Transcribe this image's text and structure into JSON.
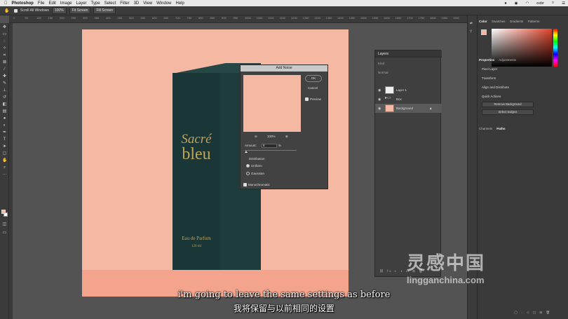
{
  "menubar": {
    "app": "Photoshop",
    "items": [
      "File",
      "Edit",
      "Image",
      "Layer",
      "Type",
      "Select",
      "Filter",
      "3D",
      "View",
      "Window",
      "Help"
    ],
    "user": "oxbr"
  },
  "options_bar": {
    "scroll_all_windows": "Scroll All Windows",
    "zoom": "100%",
    "fit_screen": "Fit Screen",
    "fill_screen": "Fill Screen"
  },
  "ruler": {
    "ticks": [
      "0",
      "50",
      "100",
      "150",
      "200",
      "250",
      "300",
      "350",
      "400",
      "450",
      "500",
      "550",
      "600",
      "650",
      "700",
      "750",
      "800",
      "850",
      "900",
      "950",
      "1000",
      "1050",
      "1100",
      "1150",
      "1200",
      "1250",
      "1300",
      "1350",
      "1400",
      "1450",
      "1500",
      "1550",
      "1600",
      "1650",
      "1700",
      "1750",
      "1800",
      "1850",
      "1900"
    ]
  },
  "product": {
    "brand_line1": "Sacré",
    "brand_line2": "bleu",
    "product_type": "Eau de Parfum",
    "volume": "120 ml"
  },
  "add_noise": {
    "title": "Add Noise",
    "ok": "OK",
    "cancel": "Cancel",
    "preview": "Preview",
    "zoom": "100%",
    "amount_label": "Amount:",
    "amount_value": "6",
    "amount_unit": "%",
    "distribution_label": "Distribution",
    "uniform": "Uniform",
    "gaussian": "Gaussian",
    "monochromatic": "Monochromatic"
  },
  "layers_panel": {
    "tab": "Layers",
    "kind": "Kind",
    "blend": "Normal",
    "layers": [
      {
        "name": "Layer 1"
      },
      {
        "name": "Box"
      },
      {
        "name": "Background"
      }
    ]
  },
  "color_panel": {
    "tabs": [
      "Color",
      "Swatches",
      "Gradients",
      "Patterns"
    ]
  },
  "properties_panel": {
    "tabs": [
      "Properties",
      "Adjustments"
    ],
    "pixel_layer": "Pixel Layer",
    "transform": "Transform",
    "align": "Align and Distribute",
    "quick_actions": "Quick Actions",
    "remove_bg": "Remove Background",
    "select_subject": "Select Subject"
  },
  "bottom_tabs": [
    "Channels",
    "Paths"
  ],
  "subtitle": {
    "en": "i'm going to leave the same settings as before",
    "zh": "我将保留与以前相同的设置"
  },
  "watermark": {
    "cn": "灵感中国",
    "url": "lingganchina.com"
  }
}
